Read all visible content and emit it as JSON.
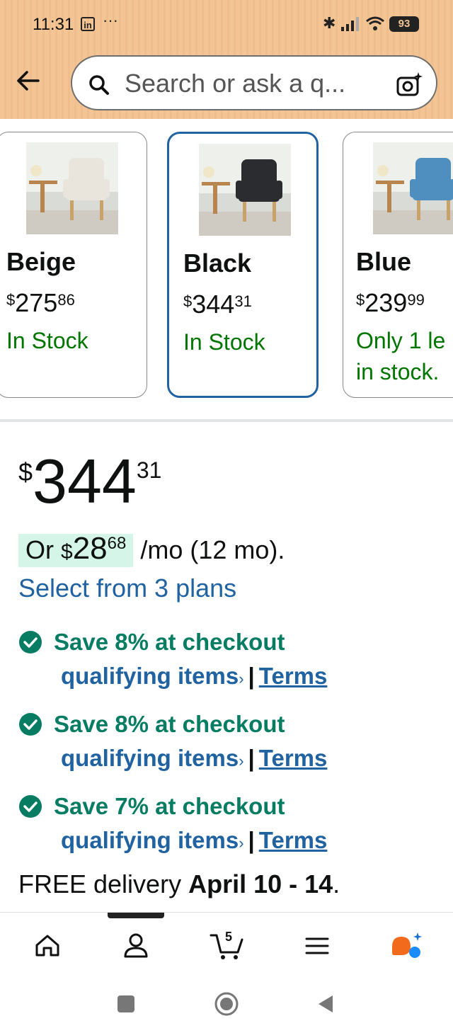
{
  "status_bar": {
    "time": "11:31",
    "app_icon": "LinkedIn",
    "more": "···",
    "battery": "93"
  },
  "search": {
    "placeholder": "Search or ask a q..."
  },
  "variants": [
    {
      "name": "Beige",
      "price_currency": "$",
      "price_whole": "275",
      "price_cents": "86",
      "stock": "In Stock",
      "chair_color": "#e9e4dc",
      "selected": false
    },
    {
      "name": "Black",
      "price_currency": "$",
      "price_whole": "344",
      "price_cents": "31",
      "stock": "In Stock",
      "chair_color": "#2a2c30",
      "selected": true
    },
    {
      "name": "Blue",
      "price_currency": "$",
      "price_whole": "239",
      "price_cents": "99",
      "stock": "Only 1 le in stock.",
      "chair_color": "#4f8fbf",
      "selected": false
    }
  ],
  "price": {
    "currency": "$",
    "whole": "344",
    "cents": "31"
  },
  "monthly": {
    "prefix": "Or",
    "currency": "$",
    "amount": "28",
    "cents": "68",
    "suffix": "/mo (12 mo).",
    "plans_link": "Select from 3 plans"
  },
  "promos": [
    {
      "title": "Save 8% at checkout",
      "link": "qualifying items",
      "chevron": "›",
      "sep": "|",
      "terms": "Terms"
    },
    {
      "title": "Save 8% at checkout",
      "link": "qualifying items",
      "chevron": "›",
      "sep": "|",
      "terms": "Terms"
    },
    {
      "title": "Save 7% at checkout",
      "link": "qualifying items",
      "chevron": "›",
      "sep": "|",
      "terms": "Terms"
    }
  ],
  "delivery": {
    "prefix": "FREE delivery",
    "dates": "April 10 - 14",
    "suffix": "."
  },
  "bottom_nav": {
    "cart_count": "5"
  },
  "colors": {
    "header_bg": "#f3c494",
    "link_blue": "#2162a1",
    "stock_green": "#007600",
    "promo_green": "#067d62",
    "highlight": "#d4f5e8",
    "alexa_orange": "#f26b1d",
    "alexa_blue": "#1a8cff"
  },
  "icons": {
    "back": "back-arrow-icon",
    "search": "search-icon",
    "camera": "camera-icon",
    "check": "check-circle-icon",
    "home": "home-icon",
    "account": "account-icon",
    "cart": "cart-icon",
    "menu": "menu-icon",
    "alexa": "alexa-icon"
  }
}
